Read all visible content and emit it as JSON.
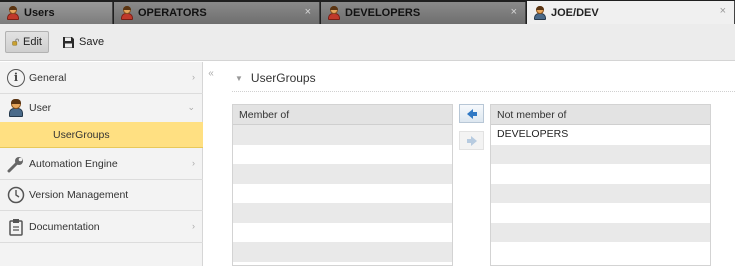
{
  "tabs": [
    {
      "label": "Users",
      "icon": "users-icon",
      "active": false,
      "closable": false
    },
    {
      "label": "OPERATORS",
      "icon": "group-icon",
      "active": false,
      "closable": true
    },
    {
      "label": "DEVELOPERS",
      "icon": "group-icon",
      "active": false,
      "closable": true
    },
    {
      "label": "JOE/DEV",
      "icon": "user-icon",
      "active": true,
      "closable": true
    }
  ],
  "tab_close_glyph": "×",
  "toolbar": {
    "edit_label": "Edit",
    "save_label": "Save"
  },
  "sidebar": {
    "items": [
      {
        "label": "General",
        "icon": "info-icon",
        "arrow": "›"
      },
      {
        "label": "User",
        "icon": "user-icon",
        "arrow": "⌄"
      },
      {
        "label": "UserGroups",
        "selected": true
      },
      {
        "label": "Automation Engine",
        "icon": "wrench-icon",
        "arrow": "›"
      },
      {
        "label": "Version Management",
        "icon": "clock-icon",
        "arrow": ""
      },
      {
        "label": "Documentation",
        "icon": "clipboard-icon",
        "arrow": "›"
      }
    ],
    "collapse_glyph": "«"
  },
  "main": {
    "section_title": "UserGroups",
    "member_of": {
      "header": "Member of",
      "rows": [
        "",
        "",
        "",
        "",
        "",
        "",
        "",
        ""
      ]
    },
    "not_member_of": {
      "header": "Not member of",
      "rows": [
        "DEVELOPERS",
        "",
        "",
        "",
        "",
        "",
        "",
        ""
      ]
    }
  },
  "colors": {
    "selected_bg": "#ffe082",
    "arrow_blue": "#2f78c4",
    "tabbar_bg": "#1f1f1f"
  }
}
